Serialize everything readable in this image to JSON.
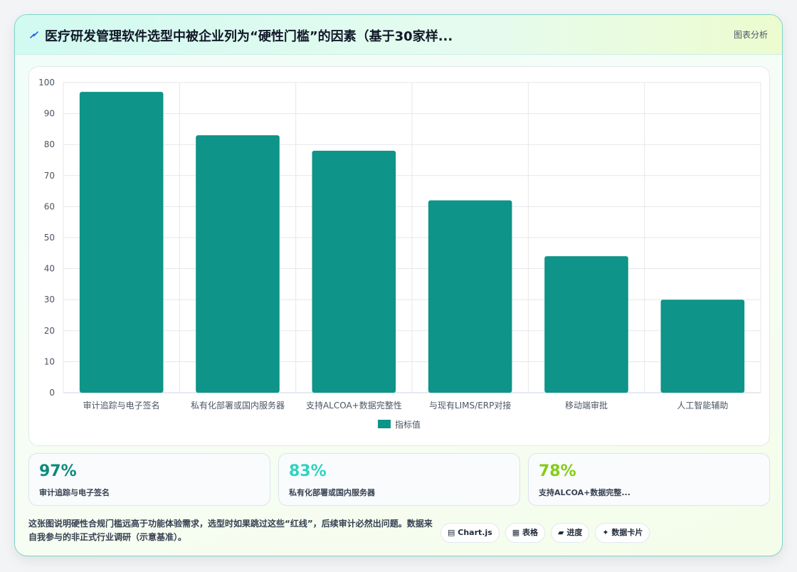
{
  "header": {
    "title": "医疗研发管理软件选型中被企业列为“硬性门槛”的因素（基于30家样...",
    "title_icon": "lightning-icon",
    "link_label": "图表分析"
  },
  "chart_data": {
    "type": "bar",
    "title": "",
    "xlabel": "",
    "ylabel": "",
    "categories": [
      "审计追踪与电子签名",
      "私有化部署或国内服务器",
      "支持ALCOA+数据完整性",
      "与现有LIMS/ERP对接",
      "移动端审批",
      "人工智能辅助"
    ],
    "series": [
      {
        "name": "指标值",
        "values": [
          97,
          83,
          78,
          62,
          44,
          30
        ]
      }
    ],
    "ylim": [
      0,
      100
    ],
    "yticks": [
      0,
      10,
      20,
      30,
      40,
      50,
      60,
      70,
      80,
      90,
      100
    ],
    "grid": true,
    "legend": "bottom",
    "bar_color": "#0e9488"
  },
  "stats": [
    {
      "value": "97%",
      "label": "审计追踪与电子签名",
      "color": "#0f8a7c"
    },
    {
      "value": "83%",
      "label": "私有化部署或国内服务器",
      "color": "#2dd4bf"
    },
    {
      "value": "78%",
      "label": "支持ALCOA+数据完整...",
      "color": "#84cc16"
    }
  ],
  "footer": {
    "text": "这张图说明硬性合规门槛远高于功能体验需求，选型时如果跳过这些“红线”，后续审计必然出问题。数据来自我参与的非正式行业调研（示意基准）。"
  },
  "tags": [
    {
      "label": "Chart.js",
      "icon": "chart-icon",
      "glyph": "▤"
    },
    {
      "label": "表格",
      "icon": "table-icon",
      "glyph": "▦"
    },
    {
      "label": "进度",
      "icon": "progress-icon",
      "glyph": "▰"
    },
    {
      "label": "数据卡片",
      "icon": "card-icon",
      "glyph": "✦"
    }
  ]
}
